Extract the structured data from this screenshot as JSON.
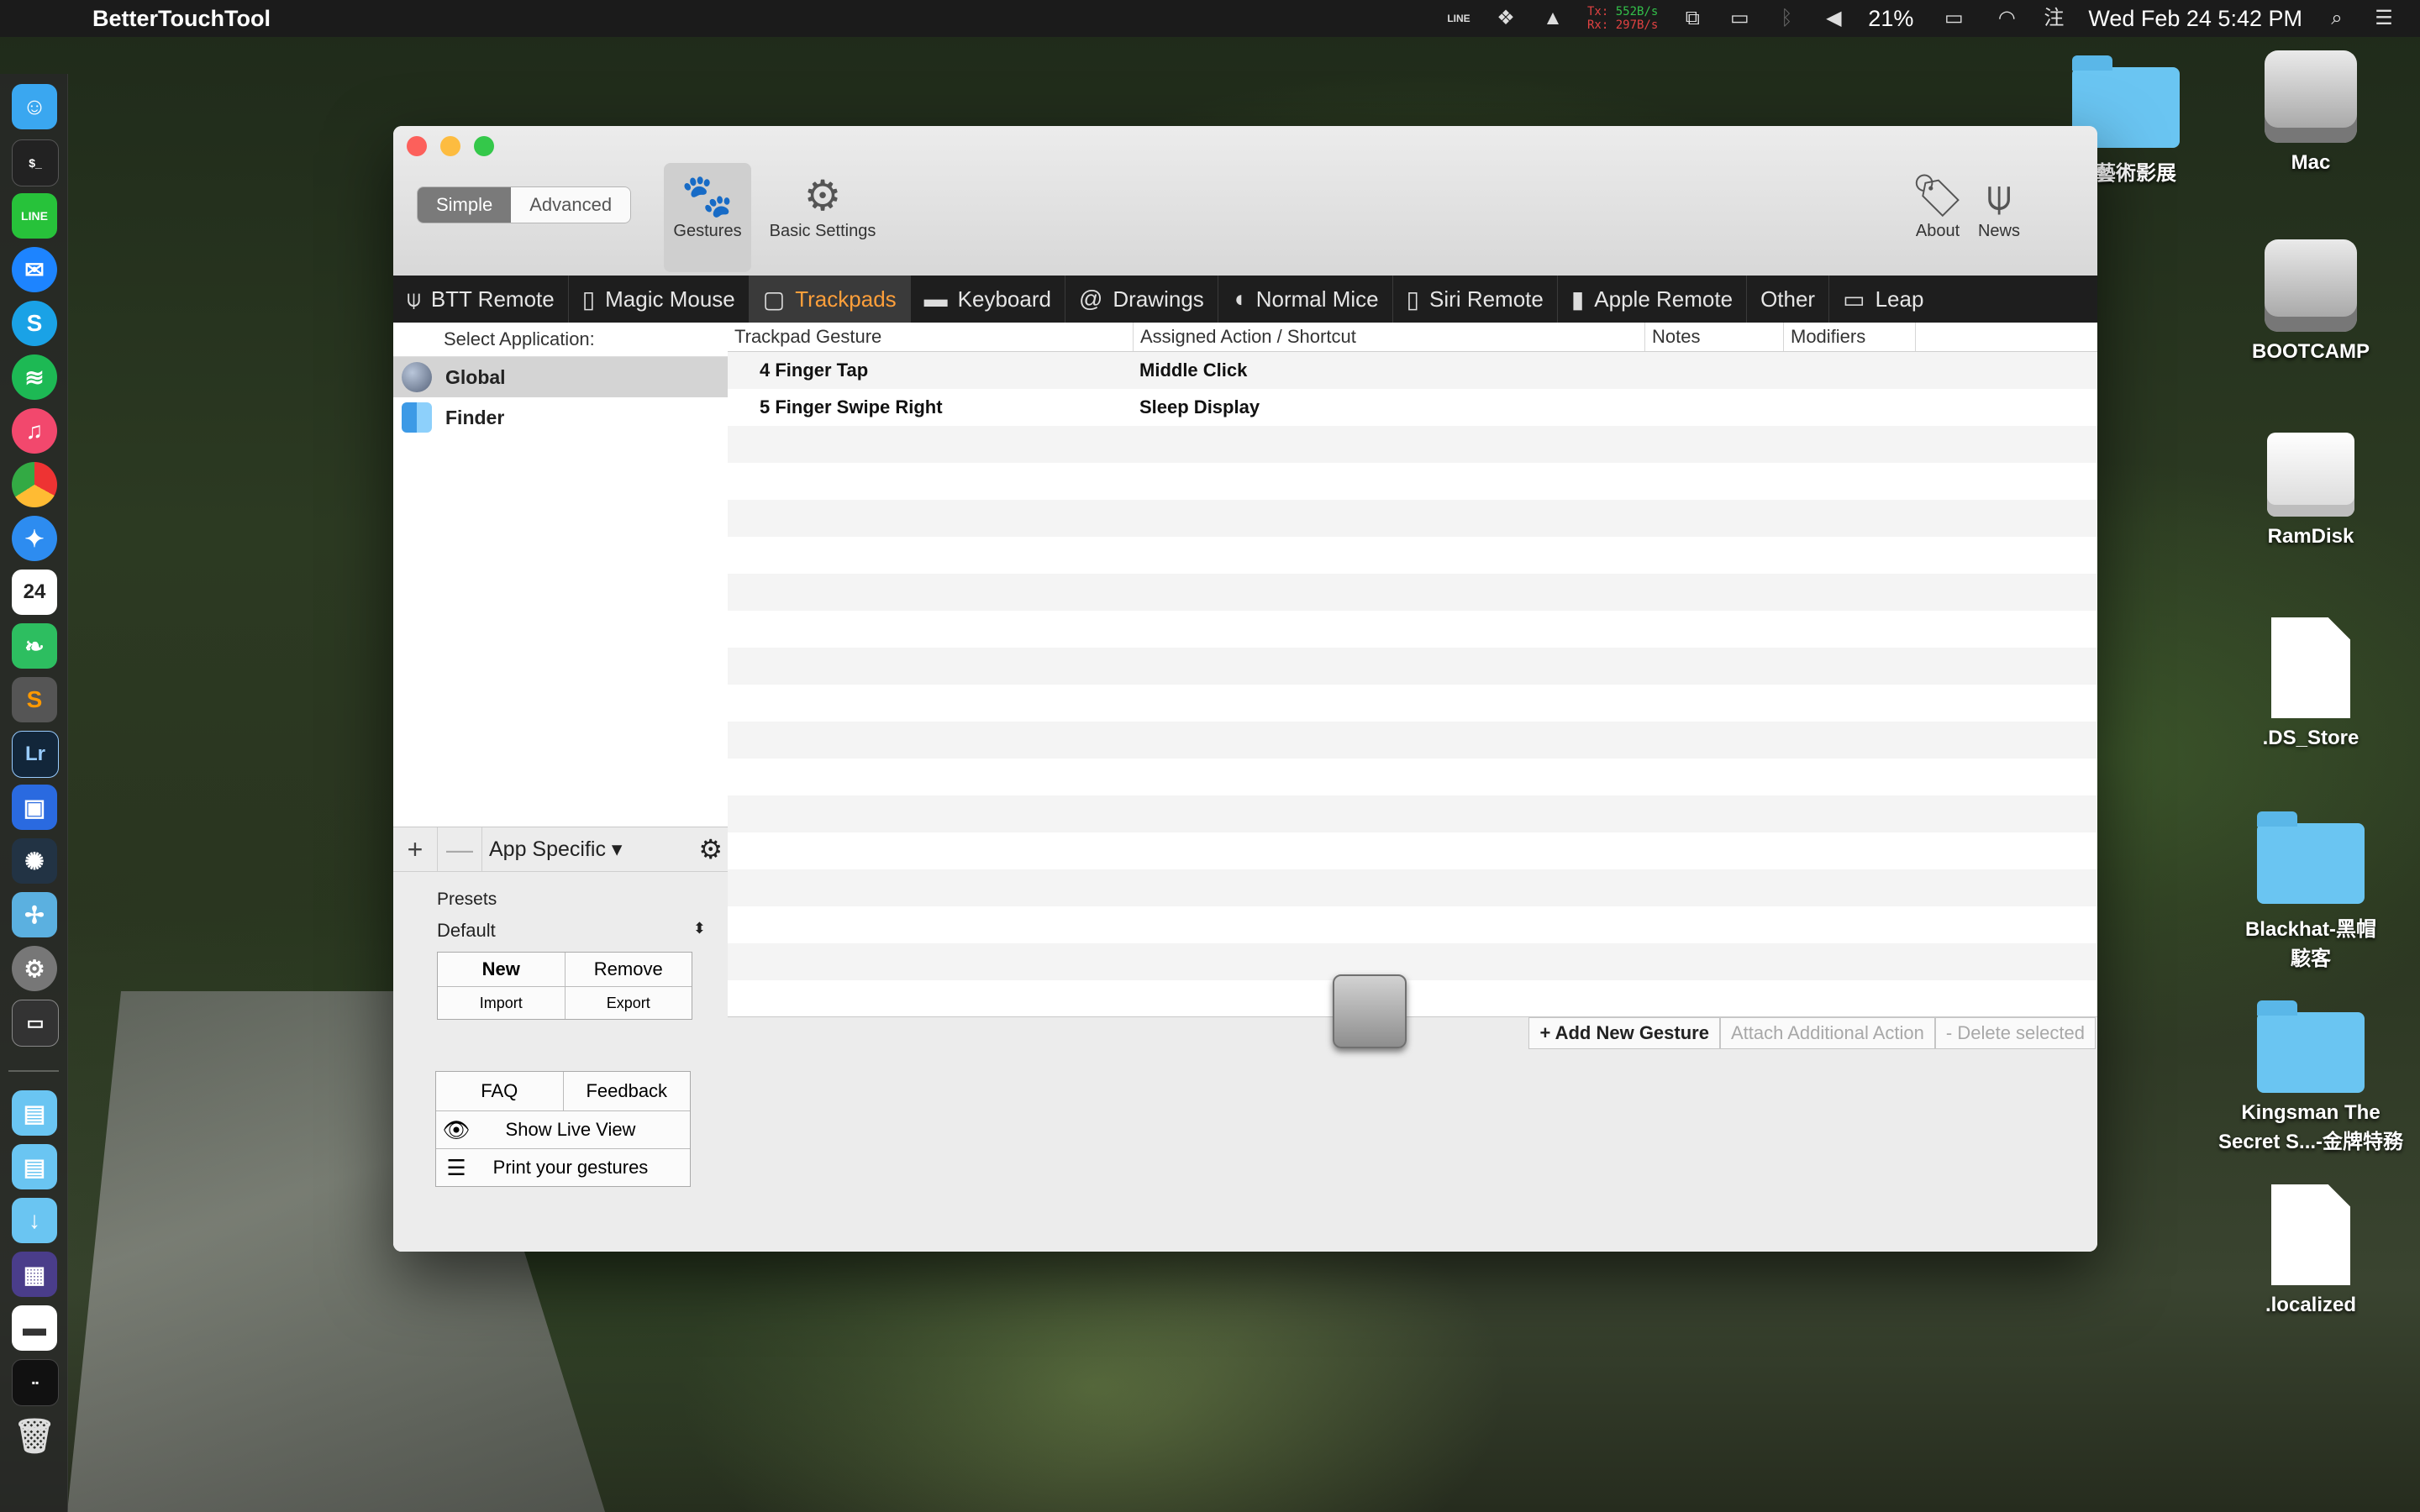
{
  "menubar": {
    "app_name": "BetterTouchTool",
    "net_tx_label": "Tx:",
    "net_tx": "552B/s",
    "net_rx_label": "Rx:",
    "net_rx": "297B/s",
    "battery": "21%",
    "clock": "Wed Feb 24  5:42 PM",
    "line_label": "LINE"
  },
  "desktop": {
    "items": [
      {
        "label": "Mac",
        "icon": "hdd-icon"
      },
      {
        "label": "BOOTCAMP",
        "icon": "hdd-icon"
      },
      {
        "label": "RamDisk",
        "icon": "drive-icon"
      },
      {
        "label": ".DS_Store",
        "icon": "document-icon"
      },
      {
        "label": "Blackhat-黑帽駭客",
        "icon": "folder-icon"
      },
      {
        "label": "Kingsman The Secret S...-金牌特務",
        "icon": "folder-icon"
      },
      {
        "label": ".localized",
        "icon": "document-icon"
      },
      {
        "label": "北藝術影展",
        "icon": "folder-icon"
      }
    ]
  },
  "window": {
    "mode_simple": "Simple",
    "mode_advanced": "Advanced",
    "toolbar": {
      "gestures": "Gestures",
      "basic_settings": "Basic Settings",
      "about": "About",
      "news": "News"
    },
    "tabs": [
      {
        "label": "BTT Remote",
        "icon": "remote-icon"
      },
      {
        "label": "Magic Mouse",
        "icon": "mouse-icon"
      },
      {
        "label": "Trackpads",
        "icon": "trackpad-icon",
        "active": true
      },
      {
        "label": "Keyboard",
        "icon": "keyboard-icon"
      },
      {
        "label": "Drawings",
        "icon": "drawing-icon"
      },
      {
        "label": "Normal Mice",
        "icon": "mouse-icon"
      },
      {
        "label": "Siri Remote",
        "icon": "remote-icon"
      },
      {
        "label": "Apple Remote",
        "icon": "remote-icon"
      },
      {
        "label": "Other",
        "icon": ""
      },
      {
        "label": "Leap",
        "icon": "leap-icon"
      }
    ],
    "apps": {
      "header": "Select Application:",
      "items": [
        {
          "label": "Global",
          "selected": true
        },
        {
          "label": "Finder",
          "selected": false
        }
      ],
      "add": "+",
      "remove": "—",
      "scope": "App Specific ▾"
    },
    "presets": {
      "label": "Presets",
      "selected": "Default",
      "new": "New",
      "remove": "Remove",
      "import": "Import",
      "export": "Export"
    },
    "help": {
      "faq": "FAQ",
      "feedback": "Feedback",
      "live_view": "Show Live View",
      "print": "Print your gestures"
    },
    "table": {
      "columns": [
        "Trackpad Gesture",
        "Assigned Action / Shortcut",
        "Notes",
        "Modifiers"
      ],
      "rows": [
        {
          "gesture": "4 Finger Tap",
          "action": "Middle Click"
        },
        {
          "gesture": "5 Finger Swipe Right",
          "action": "Sleep Display"
        }
      ]
    },
    "actions": {
      "add": "+ Add New Gesture",
      "attach": "Attach Additional Action",
      "delete": "- Delete selected"
    }
  }
}
